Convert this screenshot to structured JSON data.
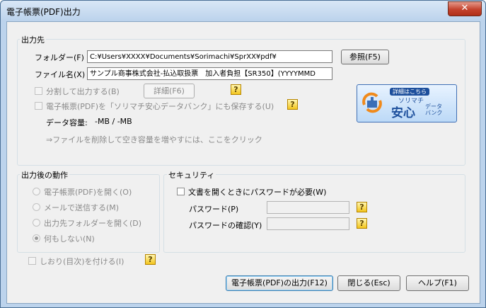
{
  "window": {
    "title": "電子帳票(PDF)出力",
    "close_glyph": "✕"
  },
  "output_dest": {
    "group_label": "出力先",
    "folder_label": "フォルダー(F)",
    "folder_value": "C:¥Users¥XXXX¥Documents¥Sorimachi¥SprXX¥pdf¥",
    "browse_button": "参照(F5)",
    "filename_label": "ファイル名(X)",
    "filename_value": "サンプル商事株式会社-払込取扱票　加入者負担【SR350】(YYYYMMD",
    "split_label": "分割して出力する(B)",
    "detail_button": "詳細(F6)",
    "save_bank_label": "電子帳票(PDF)を「ソリマチ安心データバンク」にも保存する(U)",
    "capacity_label": "データ容量:",
    "capacity_value": "-MB / -MB",
    "delete_link": "⇒ファイルを削除して空き容量を増やすには、ここをクリック"
  },
  "banner": {
    "badge": "詳細はこちら",
    "line1": "ソリマチ",
    "line2": "安心",
    "line3a": "データ",
    "line3b": "バンク"
  },
  "after_output": {
    "group_label": "出力後の動作",
    "options": [
      "電子帳票(PDF)を開く(O)",
      "メールで送信する(M)",
      "出力先フォルダーを開く(D)",
      "何もしない(N)"
    ],
    "selected_index": 3
  },
  "security": {
    "group_label": "セキュリティ",
    "password_required_label": "文書を開くときにパスワードが必要(W)",
    "password_label": "パスワード(P)",
    "password_confirm_label": "パスワードの確認(Y)"
  },
  "bookmark_label": "しおり(目次)を付ける(I)",
  "footer": {
    "output_button": "電子帳票(PDF)の出力(F12)",
    "close_button": "閉じる(Esc)",
    "help_button": "ヘルプ(F1)"
  },
  "help_glyph": "?"
}
